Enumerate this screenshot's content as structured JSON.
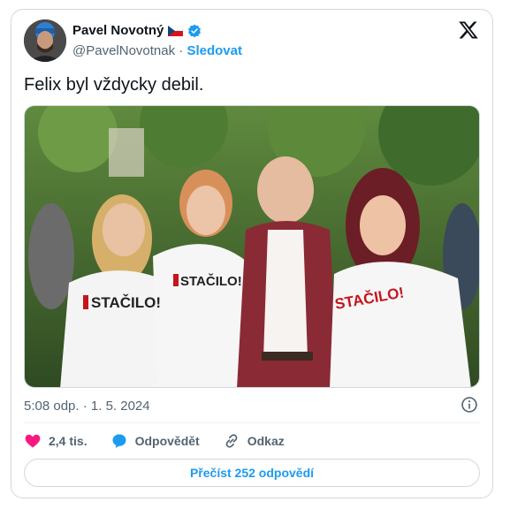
{
  "author": {
    "name": "Pavel Novotný",
    "handle": "@PavelNovotnak",
    "separator": "·",
    "follow_label": "Sledovat",
    "flag_icon": "czech-flag-icon",
    "verified_icon": "verified-badge-icon"
  },
  "tweet": {
    "text": "Felix byl vždycky debil.",
    "photo": {
      "shirt_text_1": "STAČILO!",
      "shirt_text_2": "STAČILO!",
      "shirt_text_3": "STAČILO!"
    }
  },
  "meta": {
    "timestamp": "5:08 odp. · 1. 5. 2024"
  },
  "actions": {
    "likes_count": "2,4 tis.",
    "reply_label": "Odpovědět",
    "link_label": "Odkaz"
  },
  "read_replies_label": "Přečíst 252 odpovědí",
  "colors": {
    "accent": "#1d9bf0",
    "like": "#f91880",
    "text": "#0f1419",
    "muted": "#536471",
    "border": "#cfd9de"
  }
}
